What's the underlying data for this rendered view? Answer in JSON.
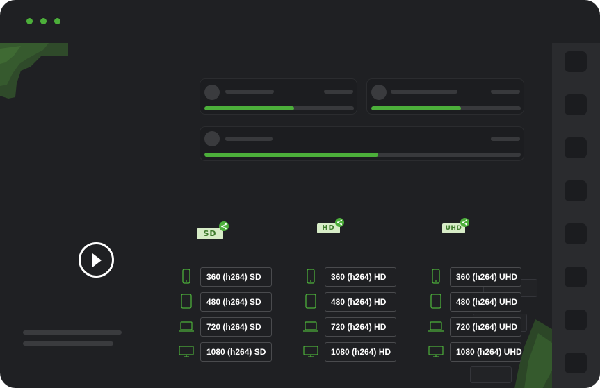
{
  "window": {
    "colors": {
      "background": "#1f2023",
      "accent": "#4caf3a",
      "badge_bg": "#d7ecc7",
      "badge_text": "#3e7b2c"
    }
  },
  "player": {
    "play_icon": "play-icon"
  },
  "upload_cards": [
    {
      "progress": 0.6
    },
    {
      "progress": 0.6
    },
    {
      "progress": 0.55
    }
  ],
  "columns": [
    {
      "badge": "SD",
      "share_icon": "share-icon",
      "rows": [
        {
          "device_icon": "phone-icon",
          "label": "360 (h264) SD"
        },
        {
          "device_icon": "tablet-icon",
          "label": "480 (h264) SD"
        },
        {
          "device_icon": "laptop-icon",
          "label": "720 (h264) SD"
        },
        {
          "device_icon": "monitor-icon",
          "label": "1080 (h264) SD"
        }
      ]
    },
    {
      "badge": "HD",
      "share_icon": "share-icon",
      "rows": [
        {
          "device_icon": "phone-icon",
          "label": "360 (h264) HD"
        },
        {
          "device_icon": "tablet-icon",
          "label": "480 (h264) HD"
        },
        {
          "device_icon": "laptop-icon",
          "label": "720 (h264) HD"
        },
        {
          "device_icon": "monitor-icon",
          "label": "1080 (h264) HD"
        }
      ]
    },
    {
      "badge": "UHD",
      "share_icon": "share-icon",
      "rows": [
        {
          "device_icon": "phone-icon",
          "label": "360 (h264) UHD"
        },
        {
          "device_icon": "tablet-icon",
          "label": "480 (h264) UHD"
        },
        {
          "device_icon": "laptop-icon",
          "label": "720 (h264) UHD"
        },
        {
          "device_icon": "monitor-icon",
          "label": "1080 (h264) UHD"
        }
      ]
    }
  ]
}
